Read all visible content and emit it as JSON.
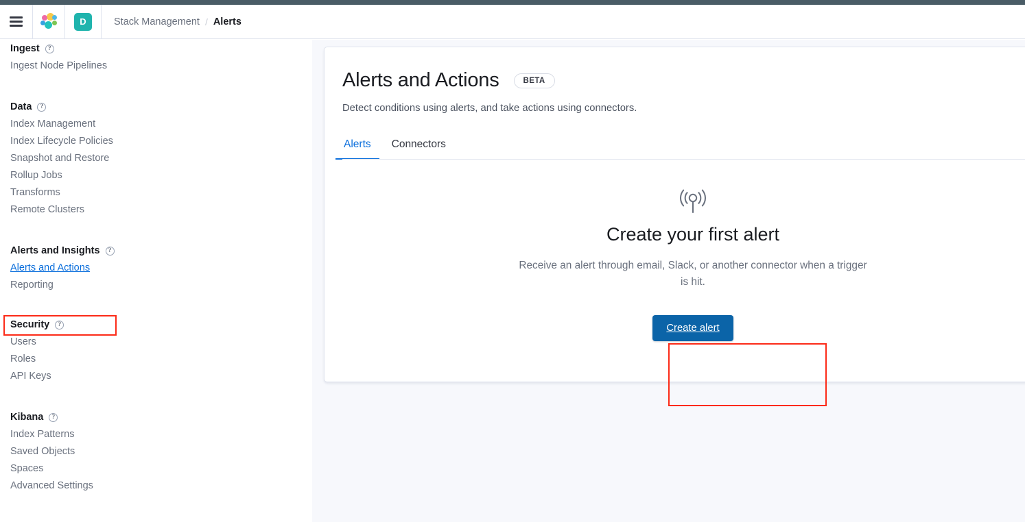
{
  "header": {
    "menu_icon": "hamburger-menu-icon",
    "logo_icon": "elastic-logo-icon",
    "avatar_initial": "D",
    "breadcrumb": {
      "parent": "Stack Management",
      "separator": "/",
      "current": "Alerts"
    }
  },
  "sidebar": {
    "groups": [
      {
        "title": "Ingest",
        "help_icon": "question-circle-icon",
        "items": [
          {
            "label": "Ingest Node Pipelines",
            "active": false
          }
        ]
      },
      {
        "title": "Data",
        "help_icon": "question-circle-icon",
        "items": [
          {
            "label": "Index Management",
            "active": false
          },
          {
            "label": "Index Lifecycle Policies",
            "active": false
          },
          {
            "label": "Snapshot and Restore",
            "active": false
          },
          {
            "label": "Rollup Jobs",
            "active": false
          },
          {
            "label": "Transforms",
            "active": false
          },
          {
            "label": "Remote Clusters",
            "active": false
          }
        ]
      },
      {
        "title": "Alerts and Insights",
        "help_icon": "question-circle-icon",
        "items": [
          {
            "label": "Alerts and Actions",
            "active": true
          },
          {
            "label": "Reporting",
            "active": false
          }
        ]
      },
      {
        "title": "Security",
        "help_icon": "question-circle-icon",
        "items": [
          {
            "label": "Users",
            "active": false
          },
          {
            "label": "Roles",
            "active": false
          },
          {
            "label": "API Keys",
            "active": false
          }
        ]
      },
      {
        "title": "Kibana",
        "help_icon": "question-circle-icon",
        "items": [
          {
            "label": "Index Patterns",
            "active": false
          },
          {
            "label": "Saved Objects",
            "active": false
          },
          {
            "label": "Spaces",
            "active": false
          },
          {
            "label": "Advanced Settings",
            "active": false
          }
        ]
      }
    ]
  },
  "main": {
    "title": "Alerts and Actions",
    "badge": "BETA",
    "subtitle": "Detect conditions using alerts, and take actions using connectors.",
    "tabs": [
      {
        "label": "Alerts",
        "selected": true
      },
      {
        "label": "Connectors",
        "selected": false
      }
    ],
    "empty_state": {
      "icon": "broadcast-icon",
      "title": "Create your first alert",
      "description": "Receive an alert through email, Slack, or another connector when a trigger is hit.",
      "button_label": "Create alert"
    }
  },
  "highlights": {
    "color": "#fc2a17",
    "targets": [
      "Alerts and Actions",
      "Create alert"
    ]
  },
  "colors": {
    "accent_blue": "#0a6edc",
    "button_blue": "#0b64a8",
    "avatar_teal": "#1fb4ad",
    "top_strip": "#4a5c66",
    "page_background": "#f7f8fc"
  }
}
